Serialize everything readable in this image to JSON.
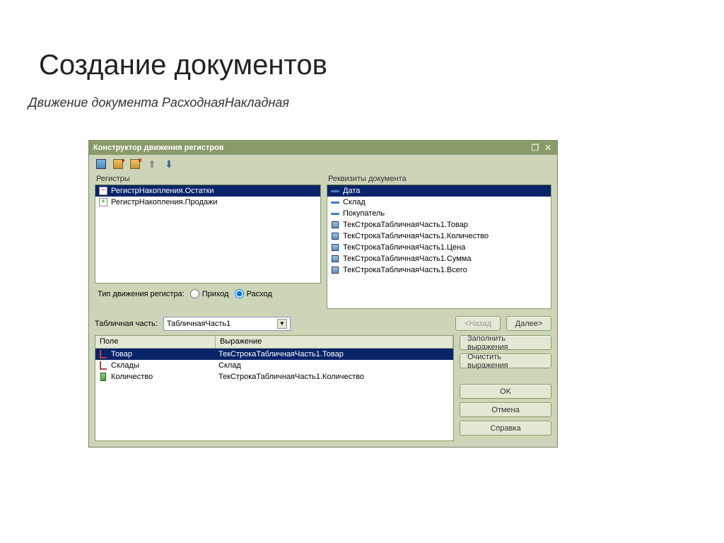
{
  "slide": {
    "title": "Создание документов",
    "subtitle": "Движение документа РасходнаяНакладная"
  },
  "dialog": {
    "title": "Конструктор движения регистров",
    "registers_label": "Регистры",
    "registers": [
      {
        "label": "РегистрНакопления.Остатки",
        "selected": true,
        "kind": "minus"
      },
      {
        "label": "РегистрНакопления.Продажи",
        "selected": false,
        "kind": "plus"
      }
    ],
    "movement_type_label": "Тип движения регистра:",
    "movement_income": "Приход",
    "movement_expense": "Расход",
    "movement_selected": "expense",
    "doc_attrs_label": "Реквизиты документа",
    "doc_attrs": [
      {
        "label": "Дата",
        "selected": true,
        "icon": "bar"
      },
      {
        "label": "Склад",
        "selected": false,
        "icon": "bar"
      },
      {
        "label": "Покупатель",
        "selected": false,
        "icon": "bar"
      },
      {
        "label": "ТекСтрокаТабличнаяЧасть1.Товар",
        "selected": false,
        "icon": "cube"
      },
      {
        "label": "ТекСтрокаТабличнаяЧасть1.Количество",
        "selected": false,
        "icon": "cube"
      },
      {
        "label": "ТекСтрокаТабличнаяЧасть1.Цена",
        "selected": false,
        "icon": "cube"
      },
      {
        "label": "ТекСтрокаТабличнаяЧасть1.Сумма",
        "selected": false,
        "icon": "cube"
      },
      {
        "label": "ТекСтрокаТабличнаяЧасть1.Всего",
        "selected": false,
        "icon": "cube"
      }
    ],
    "tab_part_label": "Табличная часть:",
    "tab_part_value": "ТабличнаяЧасть1",
    "buttons": {
      "back": "<Назад",
      "next": "Далее>",
      "fill": "Заполнить выражения",
      "clear": "Очистить выражения",
      "ok": "OK",
      "cancel": "Отмена",
      "help": "Справка"
    },
    "table": {
      "col_field": "Поле",
      "col_expr": "Выражение",
      "rows": [
        {
          "field": "Товар",
          "expr": "ТекСтрокаТабличнаяЧасть1.Товар",
          "selected": true,
          "icon": "redl"
        },
        {
          "field": "Склады",
          "expr": "Склад",
          "selected": false,
          "icon": "redl"
        },
        {
          "field": "Количество",
          "expr": "ТекСтрокаТабличнаяЧасть1.Количество",
          "selected": false,
          "icon": "green"
        }
      ]
    }
  }
}
